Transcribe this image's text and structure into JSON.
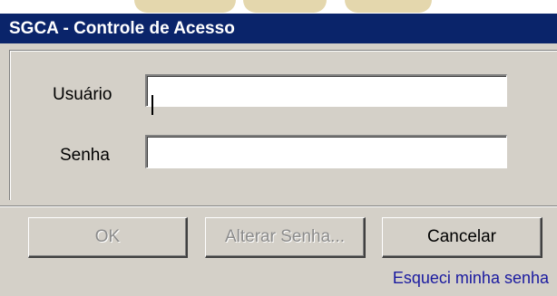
{
  "window": {
    "title": "SGCA - Controle de Acesso"
  },
  "form": {
    "user_label": "Usuário",
    "user_value": "",
    "password_label": "Senha",
    "password_value": ""
  },
  "buttons": {
    "ok_label": "OK",
    "change_password_label": "Alterar Senha...",
    "cancel_label": "Cancelar"
  },
  "links": {
    "forgot_password": "Esqueci minha senha"
  },
  "colors": {
    "titlebar": "#0a246a",
    "window_bg": "#d4d0c8",
    "link": "#1a1aa0",
    "disabled_text": "#8c8c8c"
  }
}
